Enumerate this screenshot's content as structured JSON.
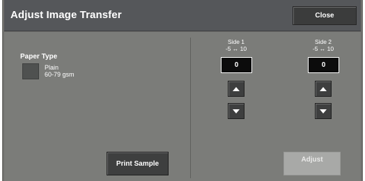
{
  "header": {
    "title": "Adjust Image Transfer",
    "close_label": "Close"
  },
  "paper": {
    "label": "Paper Type",
    "name": "Plain",
    "weight": "60-79 gsm"
  },
  "side1": {
    "label": "Side 1",
    "range": "-5 ↔ 10",
    "value": "0"
  },
  "side2": {
    "label": "Side 2",
    "range": "-5 ↔ 10",
    "value": "0"
  },
  "buttons": {
    "print_sample": "Print Sample",
    "adjust": "Adjust"
  },
  "icons": {
    "increase": "up-arrow-icon",
    "decrease": "down-arrow-icon"
  }
}
